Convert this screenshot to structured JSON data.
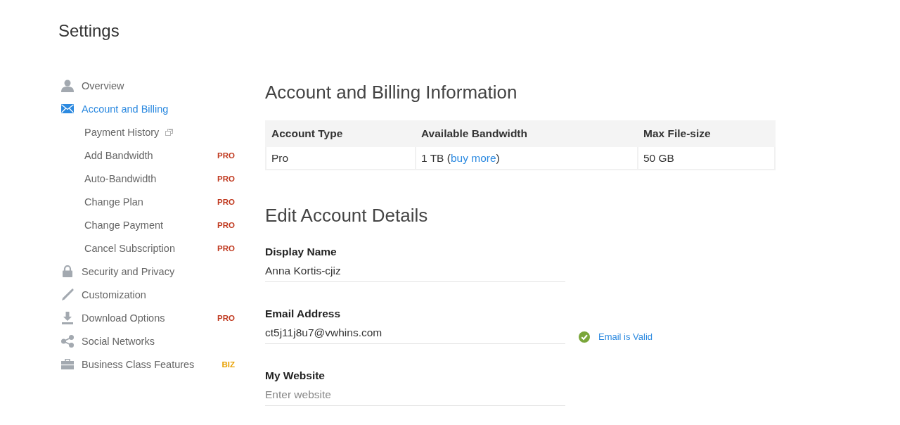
{
  "page": {
    "title": "Settings"
  },
  "sidebar": {
    "items": [
      {
        "label": "Overview",
        "selected": false
      },
      {
        "label": "Account and Billing",
        "selected": true,
        "children": [
          {
            "label": "Payment History",
            "selected": false,
            "external": true
          },
          {
            "label": "Add Bandwidth",
            "selected": false,
            "external": false,
            "badge": {
              "text": "PRO",
              "color": "#c0391f"
            }
          },
          {
            "label": "Auto-Bandwidth",
            "selected": false,
            "external": false,
            "badge": {
              "text": "PRO",
              "color": "#c0391f"
            }
          },
          {
            "label": "Change Plan",
            "selected": false,
            "external": false,
            "badge": {
              "text": "PRO",
              "color": "#c0391f"
            }
          },
          {
            "label": "Change Payment",
            "selected": false,
            "external": false,
            "badge": {
              "text": "PRO",
              "color": "#c0391f"
            }
          },
          {
            "label": "Cancel Subscription",
            "selected": false,
            "external": false,
            "badge": {
              "text": "PRO",
              "color": "#c0391f"
            }
          }
        ]
      },
      {
        "label": "Security and Privacy",
        "selected": false
      },
      {
        "label": "Customization",
        "selected": false
      },
      {
        "label": "Download Options",
        "selected": false,
        "badge": {
          "text": "PRO",
          "color": "#c0391f"
        }
      },
      {
        "label": "Social Networks",
        "selected": false
      },
      {
        "label": "Business Class Features",
        "selected": false,
        "badge": {
          "text": "BIZ",
          "color": "#e8a000"
        }
      }
    ]
  },
  "billing": {
    "heading": "Account and Billing Information",
    "table": {
      "columns": [
        "Account Type",
        "Available Bandwidth",
        "Max File-size"
      ],
      "rows": [
        [
          {
            "text": "Pro"
          },
          {
            "text": "1 TB (",
            "link": "buy more",
            "after": ")"
          },
          {
            "text": "50 GB"
          }
        ]
      ]
    }
  },
  "account_form": {
    "heading": "Edit Account Details",
    "fields": [
      {
        "label": "Display Name",
        "value": "Anna Kortis-cjiz"
      },
      {
        "label": "Email Address",
        "value": "ct5j11j8u7@vwhins.com",
        "validation": {
          "valid": true,
          "text": "Email is Valid"
        }
      },
      {
        "label": "My Website",
        "placeholder": "Enter website"
      }
    ]
  }
}
